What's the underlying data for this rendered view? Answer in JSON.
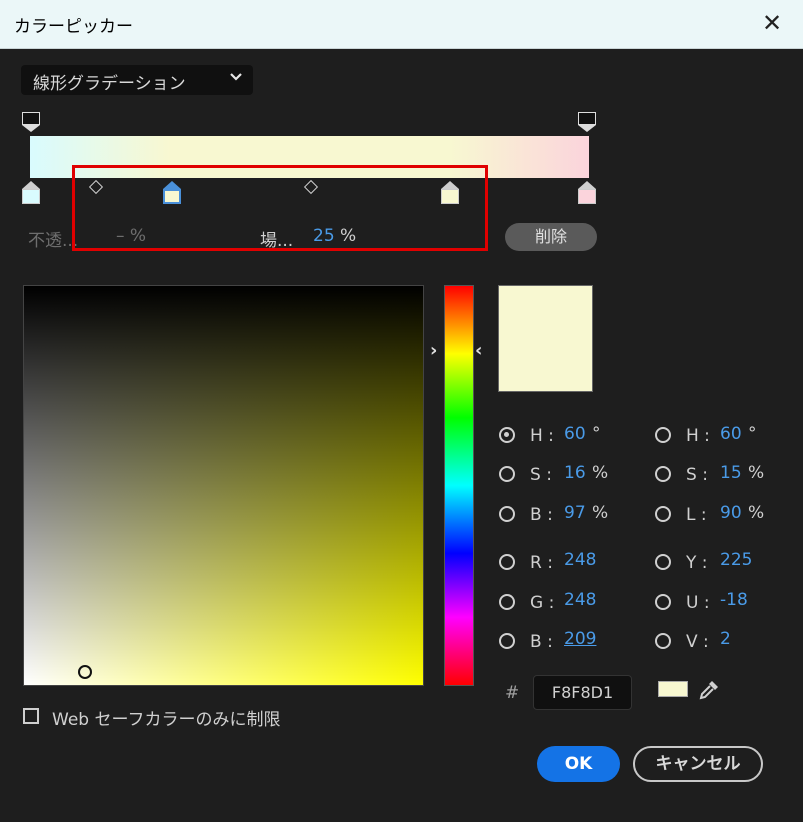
{
  "window": {
    "title": "カラーピッカー",
    "close_glyph": "✕"
  },
  "gradient_type": {
    "selected": "線形グラデーション",
    "chevron_icon": "chevron-down-icon"
  },
  "gradient": {
    "colors": [
      "#d9fbfe",
      "#f8f8d1",
      "#f8f8d1",
      "#fbd4dc"
    ]
  },
  "stop_controls": {
    "opacity_label": "不透...",
    "opacity_value": "– %",
    "location_label": "場...",
    "location_value": "25",
    "location_unit": "%",
    "delete_label": "削除"
  },
  "current_color": "#f8f8d1",
  "hsb": [
    {
      "label": "H :",
      "value": "60",
      "unit": "°",
      "selected": true
    },
    {
      "label": "S :",
      "value": "16",
      "unit": "%",
      "selected": false
    },
    {
      "label": "B :",
      "value": "97",
      "unit": "%",
      "selected": false
    }
  ],
  "hsl": [
    {
      "label": "H :",
      "value": "60",
      "unit": "°",
      "selected": false
    },
    {
      "label": "S :",
      "value": "15",
      "unit": "%",
      "selected": false
    },
    {
      "label": "L :",
      "value": "90",
      "unit": "%",
      "selected": false
    }
  ],
  "rgb": [
    {
      "label": "R :",
      "value": "248"
    },
    {
      "label": "G :",
      "value": "248"
    },
    {
      "label": "B :",
      "value": "209"
    }
  ],
  "yuv": [
    {
      "label": "Y :",
      "value": "225"
    },
    {
      "label": "U :",
      "value": "-18"
    },
    {
      "label": "V :",
      "value": "2"
    }
  ],
  "hex": {
    "hash": "#",
    "value": "F8F8D1"
  },
  "websafe_label": "Web セーフカラーのみに制限",
  "buttons": {
    "ok": "OK",
    "cancel": "キャンセル"
  }
}
